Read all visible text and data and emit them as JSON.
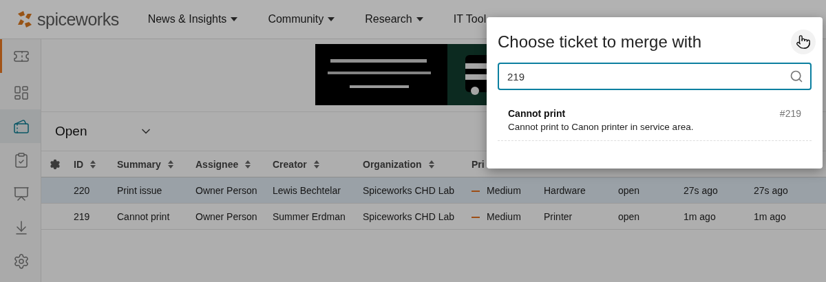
{
  "header": {
    "logo": "spiceworks",
    "nav": [
      {
        "label": "News & Insights"
      },
      {
        "label": "Community"
      },
      {
        "label": "Research"
      },
      {
        "label": "IT Tool"
      }
    ]
  },
  "sidebar": {
    "items": [
      {
        "selected": false,
        "accent": true
      },
      {
        "selected": false,
        "accent": false
      },
      {
        "selected": true,
        "accent": false
      },
      {
        "selected": false,
        "accent": false
      },
      {
        "selected": false,
        "accent": false
      },
      {
        "selected": false,
        "accent": false
      },
      {
        "selected": false,
        "accent": false
      }
    ]
  },
  "view_filter": {
    "value": "Open"
  },
  "table": {
    "columns": [
      "ID",
      "Summary",
      "Assignee",
      "Creator",
      "Organization",
      "Pri"
    ],
    "rows": [
      {
        "selected": true,
        "id": "220",
        "summary": "Print issue",
        "assignee": "Owner Person",
        "creator": "Lewis Bechtelar",
        "organization": "Spiceworks CHD Lab",
        "priority": {
          "label": "Medium",
          "color": "#9d4e16"
        },
        "category": "Hardware",
        "status": "open",
        "created": "27s ago",
        "updated": "27s ago"
      },
      {
        "selected": false,
        "id": "219",
        "summary": "Cannot print",
        "assignee": "Owner Person",
        "creator": "Summer Erdman",
        "organization": "Spiceworks CHD Lab",
        "priority": {
          "label": "Medium",
          "color": "#9d4e16"
        },
        "category": "Printer",
        "status": "open",
        "created": "1m ago",
        "updated": "1m ago"
      }
    ]
  },
  "dialog": {
    "title": "Choose ticket to merge with",
    "search": {
      "value": "219"
    },
    "results": [
      {
        "title": "Cannot print",
        "number": "#219",
        "description": "Cannot print to Canon printer in service area."
      }
    ]
  }
}
